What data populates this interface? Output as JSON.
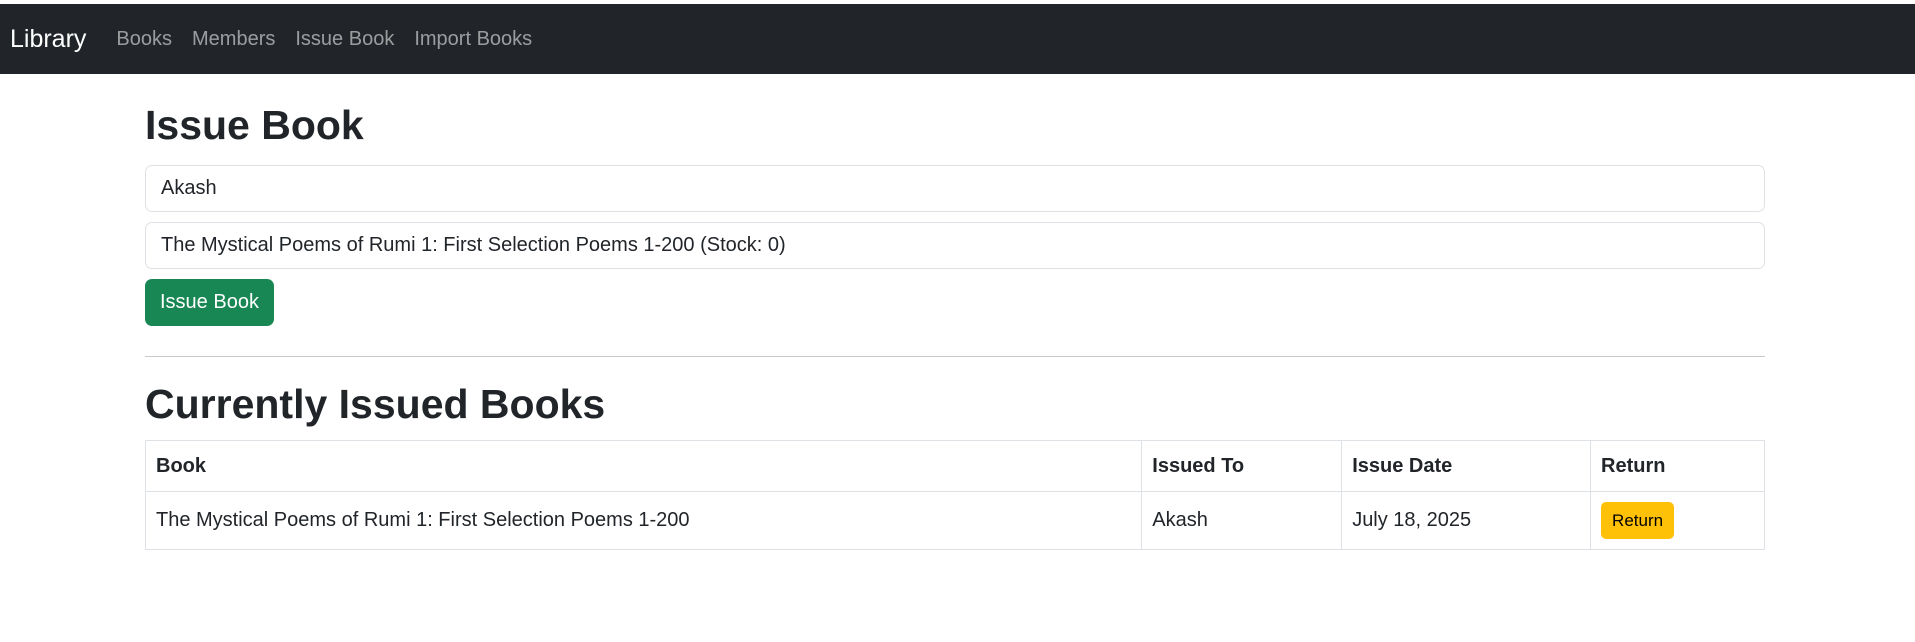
{
  "nav": {
    "brand": "Library",
    "links": [
      "Books",
      "Members",
      "Issue Book",
      "Import Books"
    ]
  },
  "issue_form": {
    "title": "Issue Book",
    "member_value": "Akash",
    "book_value": "The Mystical Poems of Rumi 1: First Selection Poems 1-200 (Stock: 0)",
    "submit_label": "Issue Book"
  },
  "issued": {
    "title": "Currently Issued Books",
    "headers": [
      "Book",
      "Issued To",
      "Issue Date",
      "Return"
    ],
    "rows": [
      {
        "book": "The Mystical Poems of Rumi 1: First Selection Poems 1-200",
        "issued_to": "Akash",
        "issue_date": "July 18, 2025",
        "return_label": "Return"
      }
    ]
  },
  "colors": {
    "navbar_bg": "#212529",
    "issue_button": "#198754",
    "return_button": "#ffc107"
  }
}
